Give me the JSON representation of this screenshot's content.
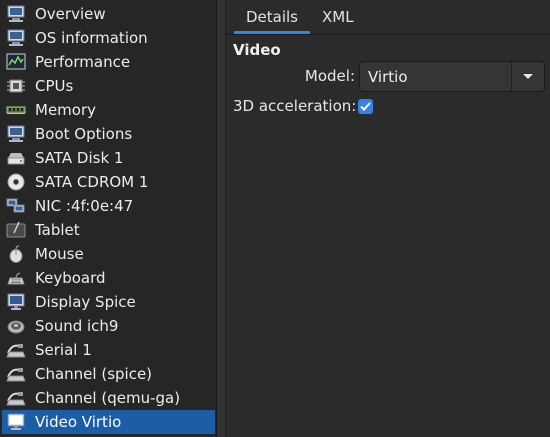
{
  "sidebar": {
    "items": [
      {
        "label": "Overview",
        "icon": "monitor-icon"
      },
      {
        "label": "OS information",
        "icon": "monitor-icon"
      },
      {
        "label": "Performance",
        "icon": "performance-graph-icon"
      },
      {
        "label": "CPUs",
        "icon": "cpu-chip-icon"
      },
      {
        "label": "Memory",
        "icon": "memory-module-icon"
      },
      {
        "label": "Boot Options",
        "icon": "monitor-icon"
      },
      {
        "label": "SATA Disk 1",
        "icon": "hard-disk-icon"
      },
      {
        "label": "SATA CDROM 1",
        "icon": "cdrom-icon"
      },
      {
        "label": "NIC :4f:0e:47",
        "icon": "network-icon"
      },
      {
        "label": "Tablet",
        "icon": "tablet-icon"
      },
      {
        "label": "Mouse",
        "icon": "mouse-icon"
      },
      {
        "label": "Keyboard",
        "icon": "keyboard-icon"
      },
      {
        "label": "Display Spice",
        "icon": "display-icon"
      },
      {
        "label": "Sound ich9",
        "icon": "sound-icon"
      },
      {
        "label": "Serial 1",
        "icon": "serial-port-icon"
      },
      {
        "label": "Channel (spice)",
        "icon": "serial-port-icon"
      },
      {
        "label": "Channel (qemu-ga)",
        "icon": "serial-port-icon"
      },
      {
        "label": "Video Virtio",
        "icon": "video-display-icon",
        "selected": true
      }
    ]
  },
  "tabs": [
    {
      "label": "Details",
      "active": true
    },
    {
      "label": "XML",
      "active": false
    }
  ],
  "video": {
    "section_title": "Video",
    "model_label": "Model:",
    "model_value": "Virtio",
    "accel_label": "3D acceleration:",
    "accel_checked": true
  },
  "colors": {
    "background": "#2b2b2b",
    "sidebar_bg": "#262626",
    "selection": "#1c5da8",
    "accent": "#3584e4"
  }
}
